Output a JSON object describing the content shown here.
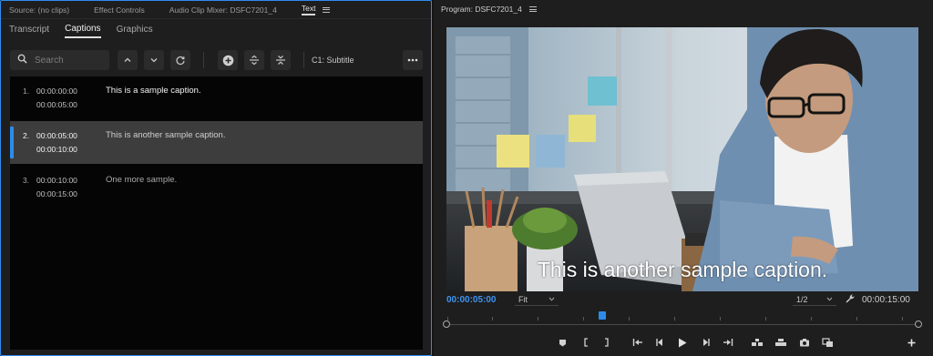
{
  "source_panel": {
    "tabs": [
      {
        "label": "Source: (no clips)"
      },
      {
        "label": "Effect Controls"
      },
      {
        "label": "Audio Clip Mixer: DSFC7201_4"
      },
      {
        "label": "Text"
      }
    ],
    "sub_tabs": [
      {
        "label": "Transcript"
      },
      {
        "label": "Captions"
      },
      {
        "label": "Graphics"
      }
    ],
    "search_placeholder": "Search",
    "track_label": "C1: Subtitle",
    "captions": [
      {
        "index": "1.",
        "in": "00:00:00:00",
        "out": "00:00:05:00",
        "text": "This is a sample caption."
      },
      {
        "index": "2.",
        "in": "00:00:05:00",
        "out": "00:00:10:00",
        "text": "This is another sample caption."
      },
      {
        "index": "3.",
        "in": "00:00:10:00",
        "out": "00:00:15:00",
        "text": "One more sample."
      }
    ]
  },
  "program_monitor": {
    "title": "Program: DSFC7201_4",
    "caption_overlay": "This is another sample caption.",
    "current_time": "00:00:05:00",
    "fit_value": "Fit",
    "resolution_value": "1/2",
    "duration": "00:00:15:00",
    "playhead_fraction": 0.33
  },
  "colors": {
    "accent": "#2d8ceb",
    "panel_bg": "#1e1e1e",
    "list_bg": "#050505",
    "selected_row": "#3d3d3d"
  }
}
